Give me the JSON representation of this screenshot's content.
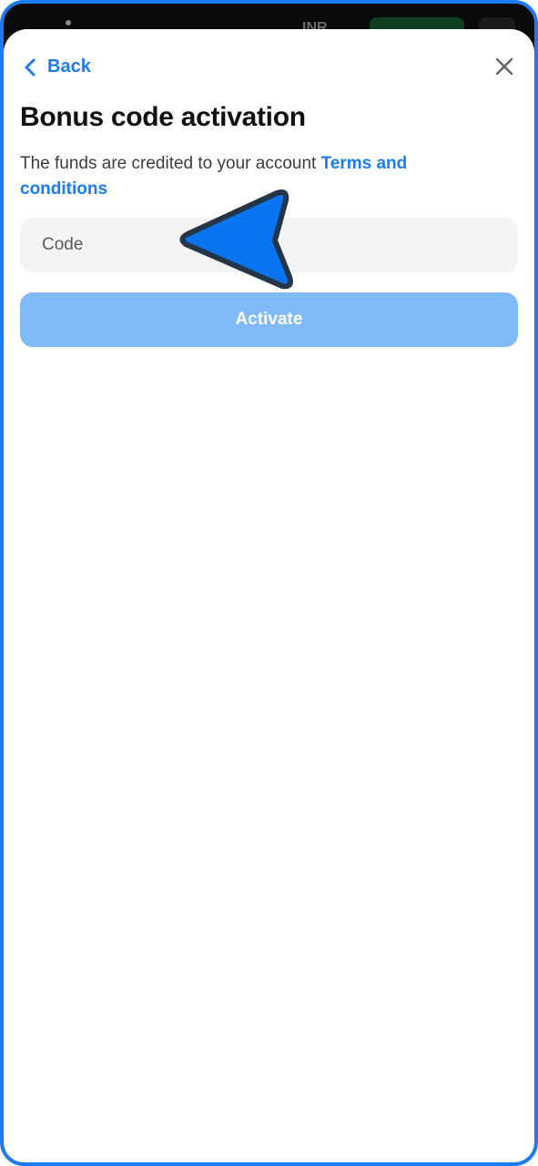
{
  "status_bar": {
    "currency": "INR"
  },
  "header": {
    "back_label": "Back"
  },
  "main": {
    "title": "Bonus code activation",
    "description": "The funds are credited to your account ",
    "terms_link": "Terms and conditions",
    "code_placeholder": "Code",
    "code_value": "",
    "activate_label": "Activate"
  },
  "colors": {
    "accent": "#1a7cf0",
    "button_disabled": "#80baf8",
    "input_bg": "#f4f4f4",
    "pointer_fill": "#0a74f0",
    "pointer_stroke": "#233547"
  },
  "icons": {
    "back": "chevron-left-icon",
    "close": "close-icon",
    "pointer": "cursor-arrow-icon"
  }
}
